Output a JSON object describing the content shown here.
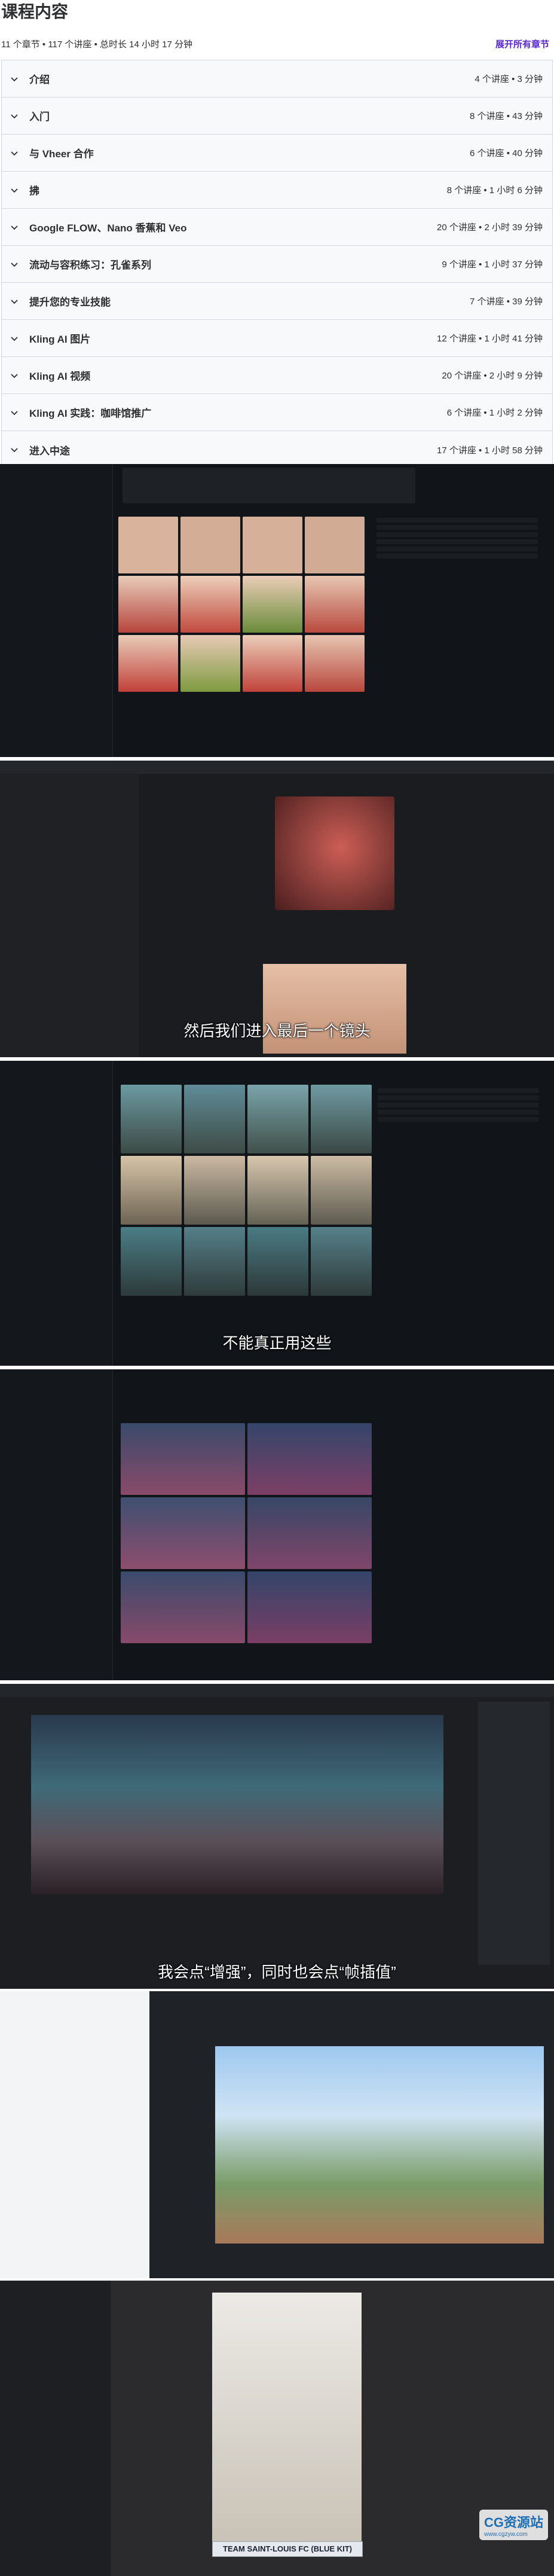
{
  "page": {
    "title": "课程内容",
    "summary": "11 个章节 • 117 个讲座 • 总时长 14 小时 17 分钟",
    "expand_all": "展开所有章节"
  },
  "sections": [
    {
      "title": "介绍",
      "meta": "4 个讲座 • 3 分钟"
    },
    {
      "title": "入门",
      "meta": "8 个讲座 • 43 分钟"
    },
    {
      "title": "与 Vheer 合作",
      "meta": "6 个讲座 • 40 分钟"
    },
    {
      "title": "拂",
      "meta": "8 个讲座 • 1 小时 6 分钟"
    },
    {
      "title": "Google FLOW、Nano 香蕉和 Veo",
      "meta": "20 个讲座 • 2 小时 39 分钟"
    },
    {
      "title": "流动与容积练习：孔雀系列",
      "meta": "9 个讲座 • 1 小时 37 分钟"
    },
    {
      "title": "提升您的专业技能",
      "meta": "7 个讲座 • 39 分钟"
    },
    {
      "title": "Kling AI 图片",
      "meta": "12 个讲座 • 1 小时 41 分钟"
    },
    {
      "title": "Kling AI 视频",
      "meta": "20 个讲座 • 2 小时 9 分钟"
    },
    {
      "title": "Kling AI 实践：咖啡馆推广",
      "meta": "6 个讲座 • 1 小时 2 分钟"
    },
    {
      "title": "进入中途",
      "meta": "17 个讲座 • 1 小时 58 分钟"
    }
  ],
  "screenshots": {
    "subtitle_1": "然后我们进入最后一个镜头",
    "subtitle_2": "不能真正用这些",
    "subtitle_3": "我会点“增强”，同时也会点“帧插值”",
    "team_bar": "TEAM SAINT-LOUIS FC (BLUE KIT)",
    "watermark_main": "CG资源站",
    "watermark_sub": "www.cgzyw.com"
  },
  "colors": {
    "accent": "#5624d0",
    "section_bg": "#f7f9fa",
    "border": "#d1d7dc",
    "dark_bg": "#111418"
  },
  "icons": {
    "section_chevron": "chevron-down-icon"
  }
}
